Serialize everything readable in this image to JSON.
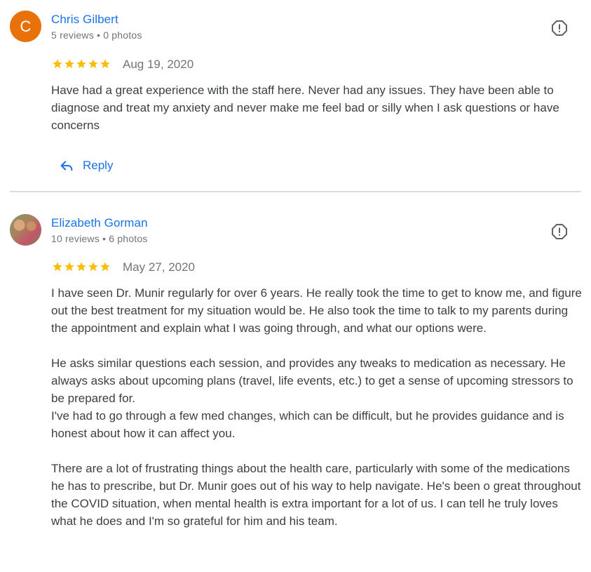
{
  "reviews": [
    {
      "avatar_letter": "C",
      "avatar_color": "#e8710a",
      "name": "Chris Gilbert",
      "meta": "5 reviews • 0 photos",
      "rating": 5,
      "date": "Aug 19, 2020",
      "text": "Have had a great experience with the staff here. Never had any issues. They have been able to diagnose and treat my anxiety and never make me feel bad or silly when I ask questions or have concerns",
      "reply_label": "Reply"
    },
    {
      "name": "Elizabeth Gorman",
      "meta": "10 reviews • 6 photos",
      "rating": 5,
      "date": "May 27, 2020",
      "text": "I have seen Dr. Munir regularly for over 6 years. He really took the time to get to know me, and figure out the best treatment for my situation would be. He also took the time to talk to my parents during the appointment and explain what I was going through, and what our options were.\n\nHe asks similar questions each session, and provides any tweaks to medication as necessary. He always asks about upcoming plans (travel, life events, etc.) to get a sense of upcoming stressors to be prepared for.\nI've had to go through a few med changes, which can be difficult, but he provides guidance and is honest about how it can affect you.\n\nThere are a lot of frustrating things about the health care, particularly with some of the medications he has to prescribe, but Dr. Munir goes out of his way to help navigate. He's been o great throughout the COVID situation, when mental health is extra important for a lot of us. I can tell he truly loves what he does and I'm so grateful for him and his team."
    }
  ],
  "colors": {
    "link": "#1a73e8",
    "star": "#fbbc04",
    "meta": "#70757a",
    "text": "#3c4043"
  },
  "icons": {
    "flag": "report-flag-icon",
    "reply": "reply-arrow-icon",
    "star": "star-icon"
  }
}
